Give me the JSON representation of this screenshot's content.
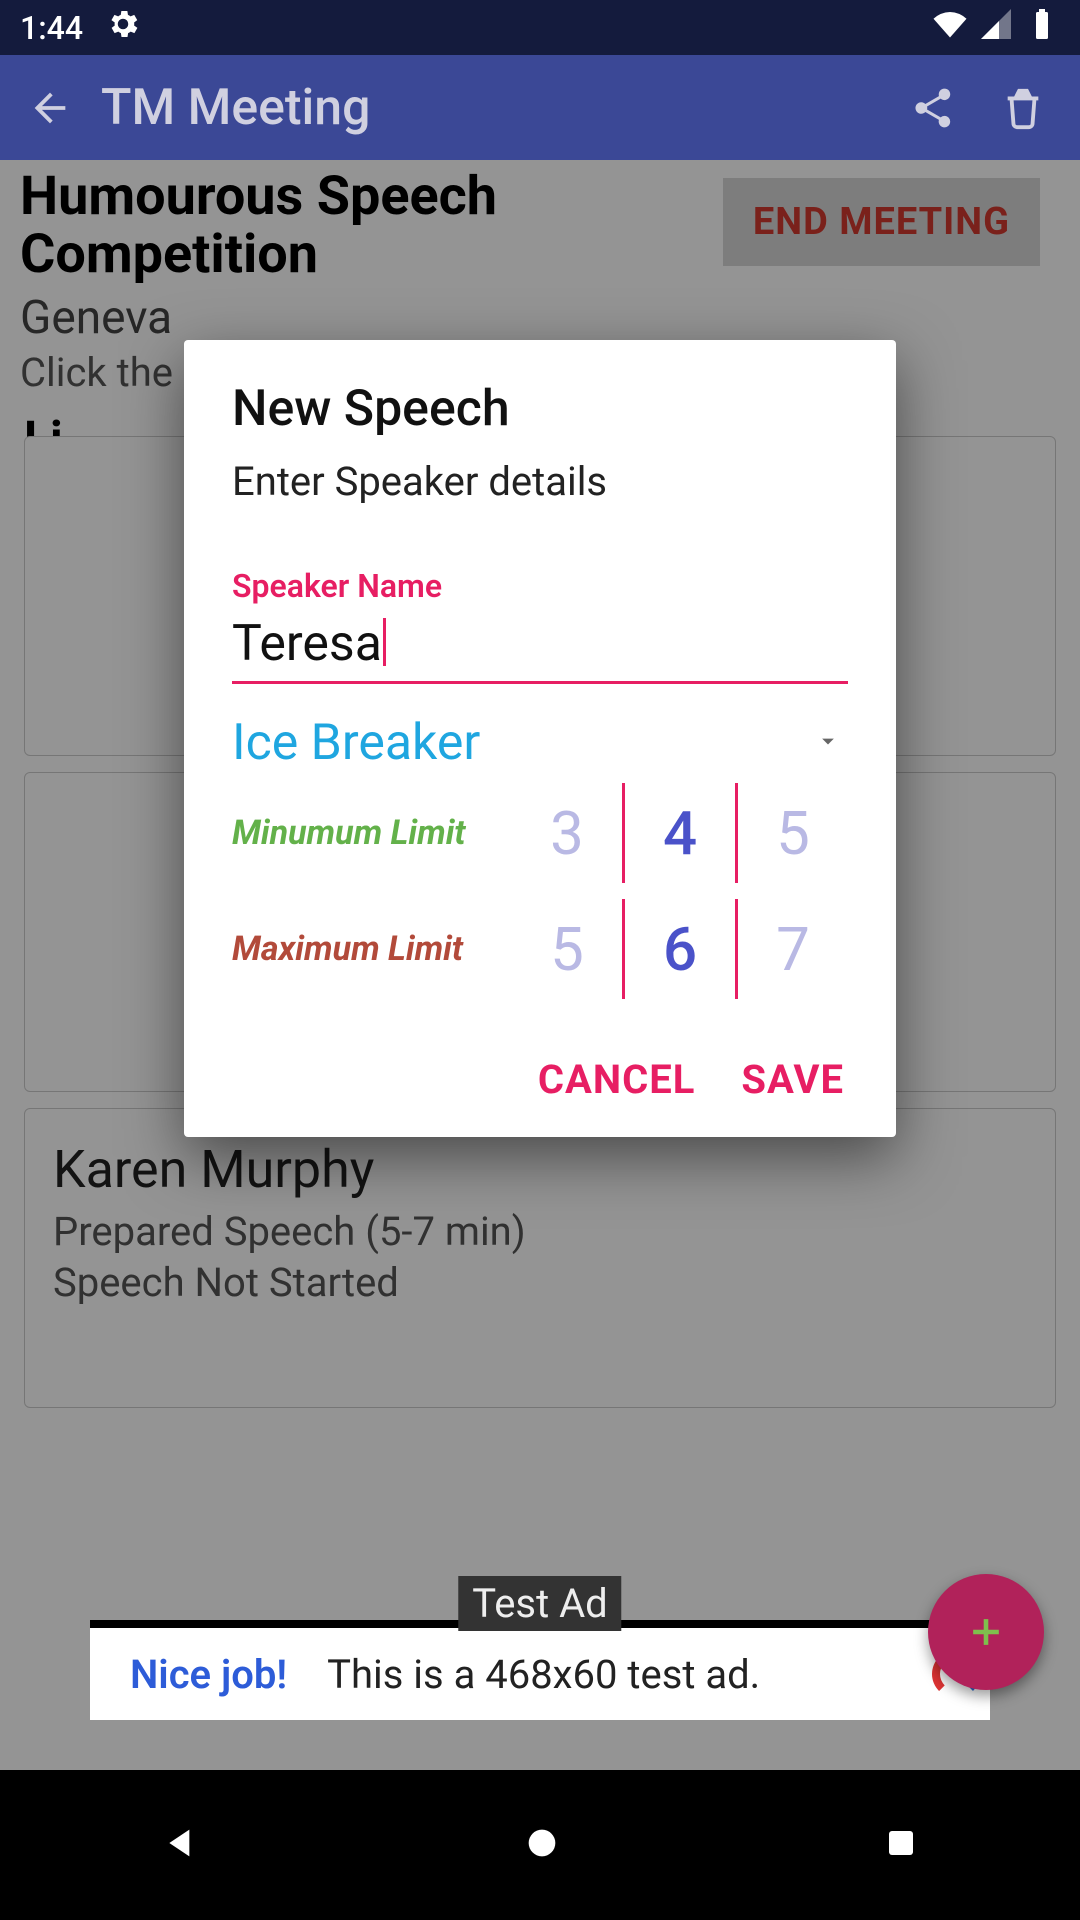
{
  "status": {
    "time": "1:44"
  },
  "appbar": {
    "title": "TM Meeting"
  },
  "meeting": {
    "title": "Humourous Speech Competition",
    "location": "Geneva",
    "hint": "Click the '+' icon to add a new speech.",
    "end_button": "END MEETING",
    "section": "Li"
  },
  "cards": {
    "karen": {
      "name": "Karen Murphy",
      "detail": "Prepared Speech (5-7 min)",
      "status": "Speech Not Started"
    }
  },
  "ad": {
    "tag": "Test Ad",
    "left": "Nice job!",
    "text": "This is a 468x60 test ad."
  },
  "dialog": {
    "title": "New Speech",
    "subtitle": "Enter Speaker details",
    "speaker_label": "Speaker Name",
    "speaker_value": "Teresa",
    "type_value": "Ice Breaker",
    "min_label": "Minumum Limit",
    "min_picker": {
      "prev": "3",
      "sel": "4",
      "next": "5"
    },
    "max_label": "Maximum Limit",
    "max_picker": {
      "prev": "5",
      "sel": "6",
      "next": "7"
    },
    "cancel": "CANCEL",
    "save": "SAVE"
  }
}
